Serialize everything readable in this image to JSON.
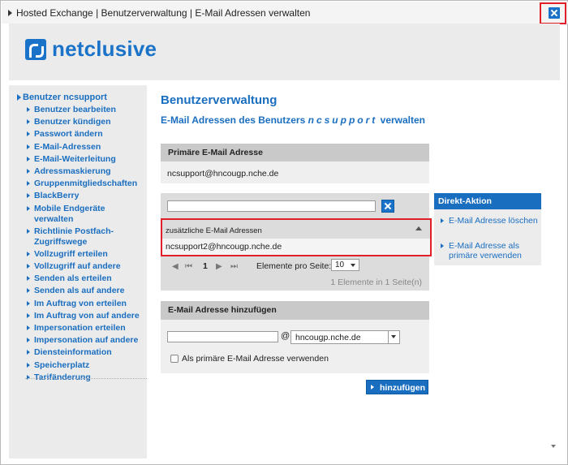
{
  "window": {
    "breadcrumb": "Hosted Exchange | Benutzerverwaltung | E-Mail Adressen verwalten"
  },
  "header": {
    "logo_text": "netclusive"
  },
  "sidebar": {
    "root": "Benutzer ncsupport",
    "items": [
      "Benutzer bearbeiten",
      "Benutzer kündigen",
      "Passwort ändern",
      "E-Mail-Adressen",
      "E-Mail-Weiterleitung",
      "Adressmaskierung",
      "Gruppenmitgliedschaften",
      "BlackBerry",
      "Mobile Endgeräte verwalten",
      "Richtlinie Postfach-\nZugriffswege",
      "Vollzugriff erteilen",
      "Vollzugriff auf andere",
      "Senden als erteilen",
      "Senden als auf andere",
      "Im Auftrag von erteilen",
      "Im Auftrag von auf andere",
      "Impersonation erteilen",
      "Impersonation auf andere",
      "Diensteinformation",
      "Speicherplatz",
      "Tarifänderung"
    ]
  },
  "main": {
    "title": "Benutzerverwaltung",
    "subtitle_prefix": "E-Mail Adressen des Benutzers",
    "subtitle_user": "ncsupport",
    "subtitle_suffix": "verwalten",
    "primary": {
      "heading": "Primäre E-Mail Adresse",
      "value": "ncsupport@hncougp.nche.de"
    },
    "grid": {
      "filter_value": "",
      "column": "zusätzliche E-Mail Adressen",
      "rows": [
        "ncsupport2@hncougp.nche.de"
      ],
      "pager": {
        "first": "⏮",
        "prev": "◀",
        "current_page": "1",
        "next": "▶",
        "last": "⏭",
        "page_size_label": "Elemente pro Seite:",
        "page_size": "10",
        "info": "1 Elemente in 1 Seite(n)"
      }
    },
    "add": {
      "heading": "E-Mail Adresse hinzufügen",
      "local_part": "",
      "at": "@",
      "domain": "hncougp.nche.de",
      "checkbox_label": "Als primäre E-Mail Adresse verwenden",
      "checkbox_checked": false,
      "button": "hinzufügen"
    }
  },
  "direct_action": {
    "heading": "Direkt-Aktion",
    "items": [
      "E-Mail Adresse löschen",
      "E-Mail Adresse als primäre verwenden"
    ]
  },
  "colors": {
    "brand_blue": "#1a6ec0",
    "highlight_red": "#e01f26"
  },
  "icons": {
    "close": "close-icon",
    "clear_filter": "clear-icon",
    "sort": "sort-up-icon"
  }
}
